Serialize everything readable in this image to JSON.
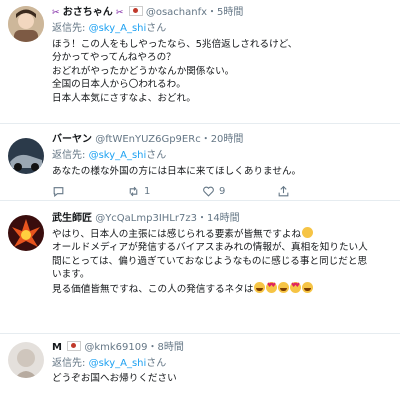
{
  "tweets": [
    {
      "name": "おさちゃん",
      "handle": "@osachanfx",
      "dot": "・",
      "time": "5時間",
      "reply_prefix": "返信先:",
      "reply_to": "@sky_A_shi",
      "reply_suffix": "さん",
      "text": "ほう！この人をもしやったなら、5兆倍返しされるけど、\n分かってやってんねやろの？\nおどれがやったかどうかなんか関係ない。\n全国の日本人から〇われるわ。\n日本人本気にさすなよ、おどれ。"
    },
    {
      "name": "バーヤン",
      "handle": "@ftWEnYUZ6Gp9ERc",
      "dot": "・",
      "time": "20時間",
      "reply_prefix": "返信先:",
      "reply_to": "@sky_A_shi",
      "reply_suffix": "さん",
      "text": "あなたの様な外国の方には日本に来てほしくありません。",
      "actions": {
        "reply": "",
        "retweet": "1",
        "like": "9"
      }
    },
    {
      "name": "武生師匠",
      "handle": "@YcQaLmp3IHLr7z3",
      "dot": "・",
      "time": "14時間",
      "text_1": "やはり、日本人の主張には感じられる要素が皆無ですよね",
      "text_2": "\nオールドメディアが発信するバイアスまみれの情報が、真相を知りたい人\n間にとっては、偏り過ぎていておなじようなものに感じる事と同じだと思\nいます。\n見る価値皆無ですね、この人の発信するネタは"
    },
    {
      "name": "M",
      "handle": "@kmk69109",
      "dot": "・",
      "time": "8時間",
      "reply_prefix": "返信先:",
      "reply_to": "@sky_A_shi",
      "reply_suffix": "さん",
      "text": "どうぞお国へお帰りください"
    }
  ],
  "icons": {
    "reply": "reply-icon",
    "retweet": "retweet-icon",
    "like": "heart-icon",
    "share": "share-icon",
    "flag": "japan-flag-icon"
  },
  "colors": {
    "link": "#1da1f2",
    "muted": "#657786",
    "separator": "#e6ecf0"
  }
}
